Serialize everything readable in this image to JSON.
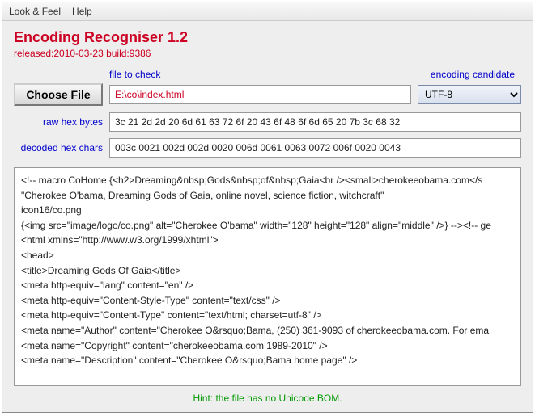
{
  "menubar": {
    "look_feel": "Look & Feel",
    "help": "Help"
  },
  "header": {
    "title": "Encoding Recogniser 1.2",
    "subtitle": "released:2010-03-23 build:9386"
  },
  "labels": {
    "file_to_check": "file to check",
    "encoding_candidate": "encoding candidate",
    "raw_hex_bytes": "raw hex bytes",
    "decoded_hex_chars": "decoded hex chars"
  },
  "buttons": {
    "choose_file": "Choose File"
  },
  "fields": {
    "file_path": "E:\\co\\index.html",
    "encoding": "UTF-8",
    "raw_hex": "3c 21 2d 2d 20 6d 61 63 72 6f 20 43 6f 48 6f 6d 65 20 7b 3c 68 32",
    "decoded_hex": "003c 0021 002d 002d 0020 006d 0061 0063 0072 006f 0020 0043"
  },
  "preview_lines": [
    "<!-- macro CoHome {<h2>Dreaming&nbsp;Gods&nbsp;of&nbsp;Gaia<br /><small>cherokeeobama.com</s",
    "\"Cherokee O'bama, Dreaming Gods of Gaia, online novel, science fiction, witchcraft\"",
    "icon16/co.png",
    "{<img src=\"image/logo/co.png\" alt=\"Cherokee O'bama\" width=\"128\" height=\"128\" align=\"middle\"  />} --><!-- ge",
    "<html xmlns=\"http://www.w3.org/1999/xhtml\">",
    "<head>",
    "<title>Dreaming Gods Of Gaia</title>",
    "<meta http-equiv=\"lang\" content=\"en\" />",
    "<meta http-equiv=\"Content-Style-Type\" content=\"text/css\" />",
    "<meta http-equiv=\"Content-Type\" content=\"text/html; charset=utf-8\" />",
    "<meta name=\"Author\" content=\"Cherokee O&rsquo;Bama, (250) 361-9093 of cherokeeobama.com. For ema",
    "<meta name=\"Copyright\" content=\"cherokeeobama.com 1989-2010\" />",
    "<meta name=\"Description\" content=\"Cherokee O&rsquo;Bama home page\" />"
  ],
  "hint": "Hint: the file has no Unicode BOM."
}
